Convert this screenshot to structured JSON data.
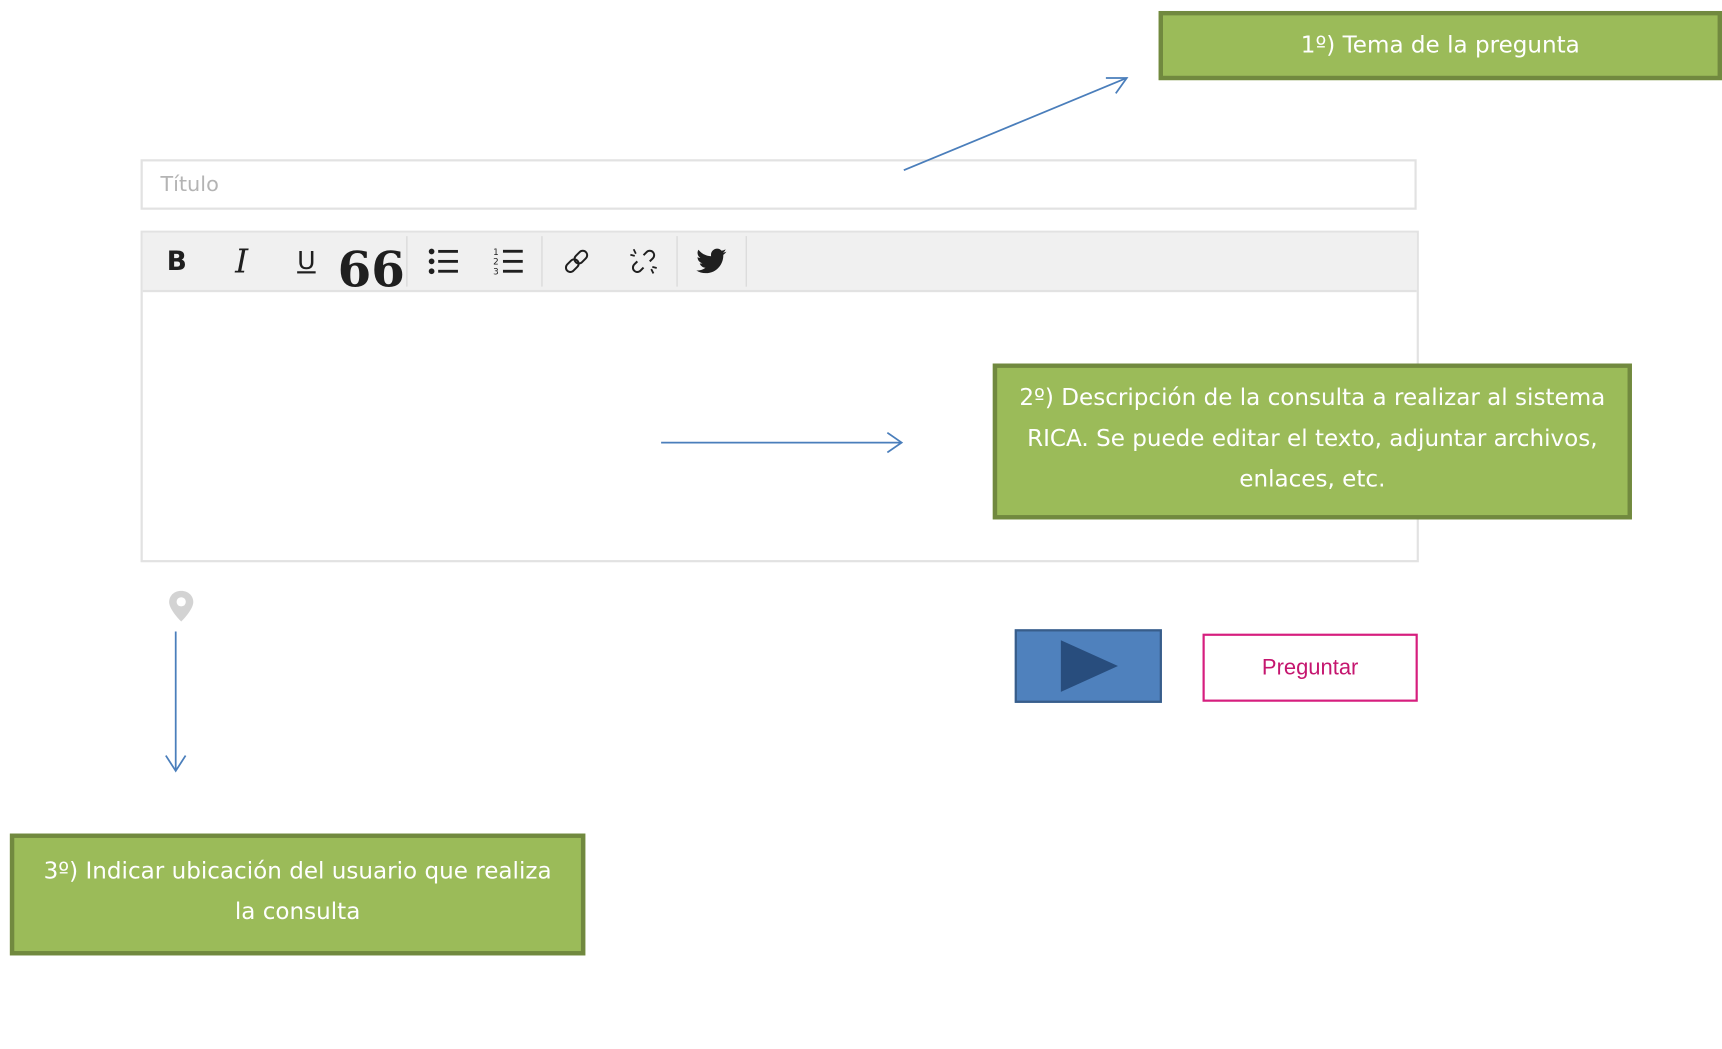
{
  "form": {
    "title_placeholder": "Título",
    "toolbar": {
      "items": [
        {
          "name": "bold",
          "glyph": "B"
        },
        {
          "name": "italic",
          "glyph": "I"
        },
        {
          "name": "underline",
          "glyph": "U"
        },
        {
          "name": "blockquote",
          "glyph": "66"
        },
        {
          "name": "bulleted-list",
          "icon": "bullet-list-icon"
        },
        {
          "name": "numbered-list",
          "icon": "numbered-list-icon"
        },
        {
          "name": "link",
          "icon": "link-icon"
        },
        {
          "name": "unlink",
          "icon": "unlink-icon"
        },
        {
          "name": "twitter",
          "icon": "twitter-icon"
        }
      ]
    },
    "location_icon": "map-pin-icon",
    "play_icon": "play-icon",
    "submit_label": "Preguntar"
  },
  "annotations": {
    "step1": "1º) Tema de la pregunta",
    "step2": "2º) Descripción de la consulta a realizar al sistema RICA. Se puede editar el texto, adjuntar archivos, enlaces, etc.",
    "step3": "3º) Indicar ubicación del usuario que realiza la consulta"
  },
  "colors": {
    "callout_fill": "#9bbb59",
    "callout_border": "#71893f",
    "arrow": "#4a7ebb",
    "submit_accent": "#d61e7e",
    "play_button": "#4f81bd"
  }
}
